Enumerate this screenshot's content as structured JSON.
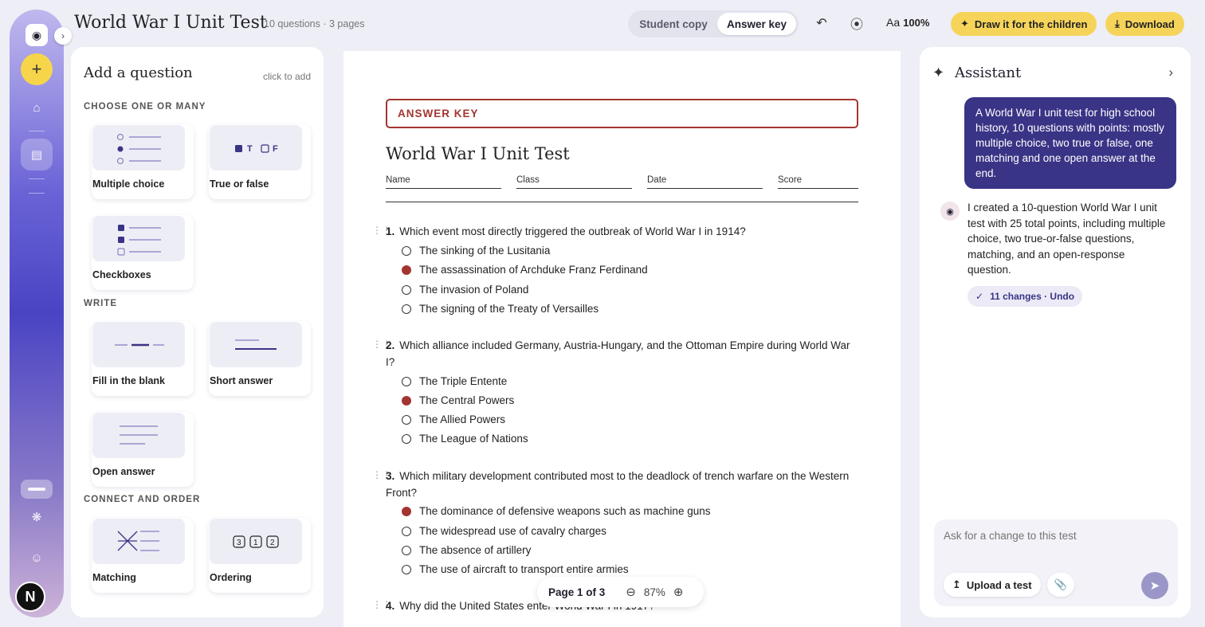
{
  "header": {
    "title": "World War I Unit Test",
    "meta": "10 questions · 3 pages",
    "view_tabs": [
      "Student copy",
      "Answer key"
    ],
    "zoom_label": "100%",
    "font_icon_label": "Aa",
    "draw_button": "Draw it for the children",
    "download_button": "Download"
  },
  "add_panel": {
    "title": "Add a question",
    "hint": "click to add",
    "sections": {
      "choose": "CHOOSE ONE OR MANY",
      "write": "WRITE",
      "connect": "CONNECT AND ORDER"
    },
    "cards": {
      "multiple_choice": "Multiple choice",
      "true_false": "True or false",
      "checkboxes": "Checkboxes",
      "fill_blank": "Fill in the blank",
      "short_answer": "Short answer",
      "open_answer": "Open answer",
      "matching": "Matching",
      "ordering": "Ordering"
    },
    "tf_thumb": {
      "t": "T",
      "f": "F"
    },
    "ordering_thumb": [
      "3",
      "1",
      "2"
    ]
  },
  "document": {
    "banner": "ANSWER KEY",
    "heading": "World War I Unit Test",
    "fields": [
      "Name",
      "Class",
      "Date",
      "Score"
    ],
    "questions": [
      {
        "num": "1.",
        "text": "Which event most directly triggered the outbreak of World War I in 1914?",
        "options": [
          "The sinking of the Lusitania",
          "The assassination of Archduke Franz Ferdinand",
          "The invasion of Poland",
          "The signing of the Treaty of Versailles"
        ],
        "correct": 1
      },
      {
        "num": "2.",
        "text": "Which alliance included Germany, Austria-Hungary, and the Ottoman Empire during World War I?",
        "options": [
          "The Triple Entente",
          "The Central Powers",
          "The Allied Powers",
          "The League of Nations"
        ],
        "correct": 1
      },
      {
        "num": "3.",
        "text": "Which military development contributed most to the deadlock of trench warfare on the Western Front?",
        "options": [
          "The dominance of defensive weapons such as machine guns",
          "The widespread use of cavalry charges",
          "The absence of artillery",
          "The use of aircraft to transport entire armies"
        ],
        "correct": 0
      },
      {
        "num": "4.",
        "text": "Why did the United States enter World War I in 1917?"
      }
    ],
    "pager": {
      "label": "Page 1 of 3",
      "zoom": "87%"
    }
  },
  "assistant": {
    "title": "Assistant",
    "user_message": "A World War I unit test for high school history, 10 questions with points: mostly multiple choice, two true or false, one matching and one open answer at the end.",
    "reply": "I created a 10-question World War I unit test with 25 total points, including multiple choice, two true-or-false questions, matching, and an open-response question.",
    "changes_chip": "11 changes · Undo",
    "composer_placeholder": "Ask for a change to this test",
    "upload_button": "Upload a test"
  },
  "user": {
    "avatar_initial": "N"
  },
  "colors": {
    "accent": "#3a3486",
    "answer_red": "#a33530",
    "highlight_yellow": "#f6d45a"
  }
}
